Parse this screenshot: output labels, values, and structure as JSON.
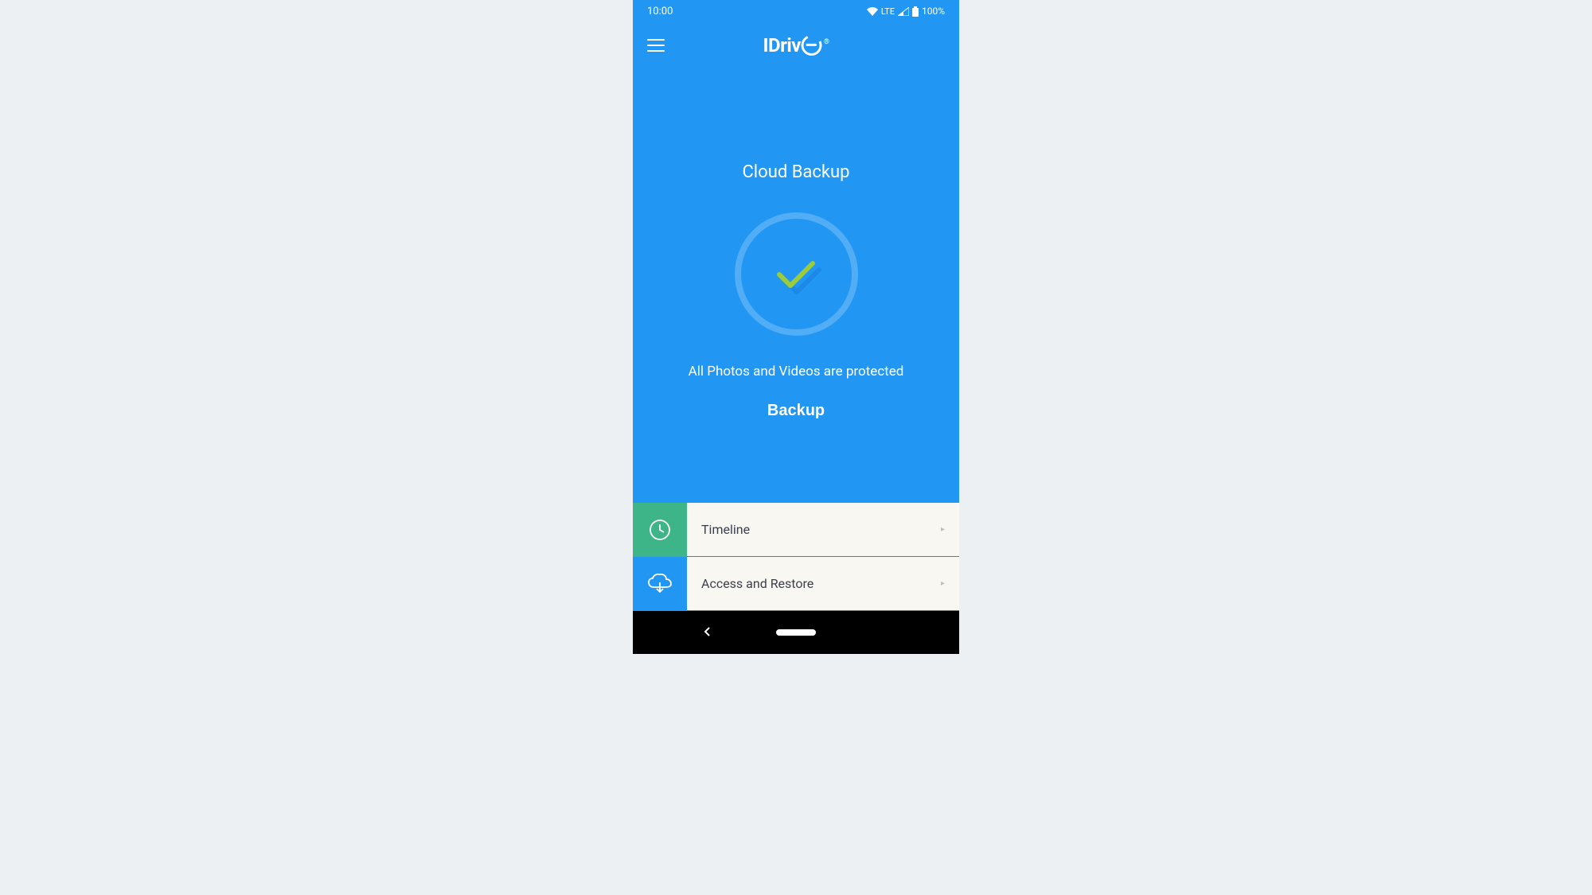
{
  "statusBar": {
    "time": "10:00",
    "network": "LTE",
    "battery": "100%"
  },
  "app": {
    "logoText": "IDriv",
    "logoTrademark": "®"
  },
  "main": {
    "title": "Cloud Backup",
    "statusText": "All Photos and Videos are protected",
    "backupLabel": "Backup"
  },
  "listItems": [
    {
      "label": "Timeline",
      "iconClass": "icon-timeline"
    },
    {
      "label": "Access and Restore",
      "iconClass": "icon-restore"
    }
  ]
}
